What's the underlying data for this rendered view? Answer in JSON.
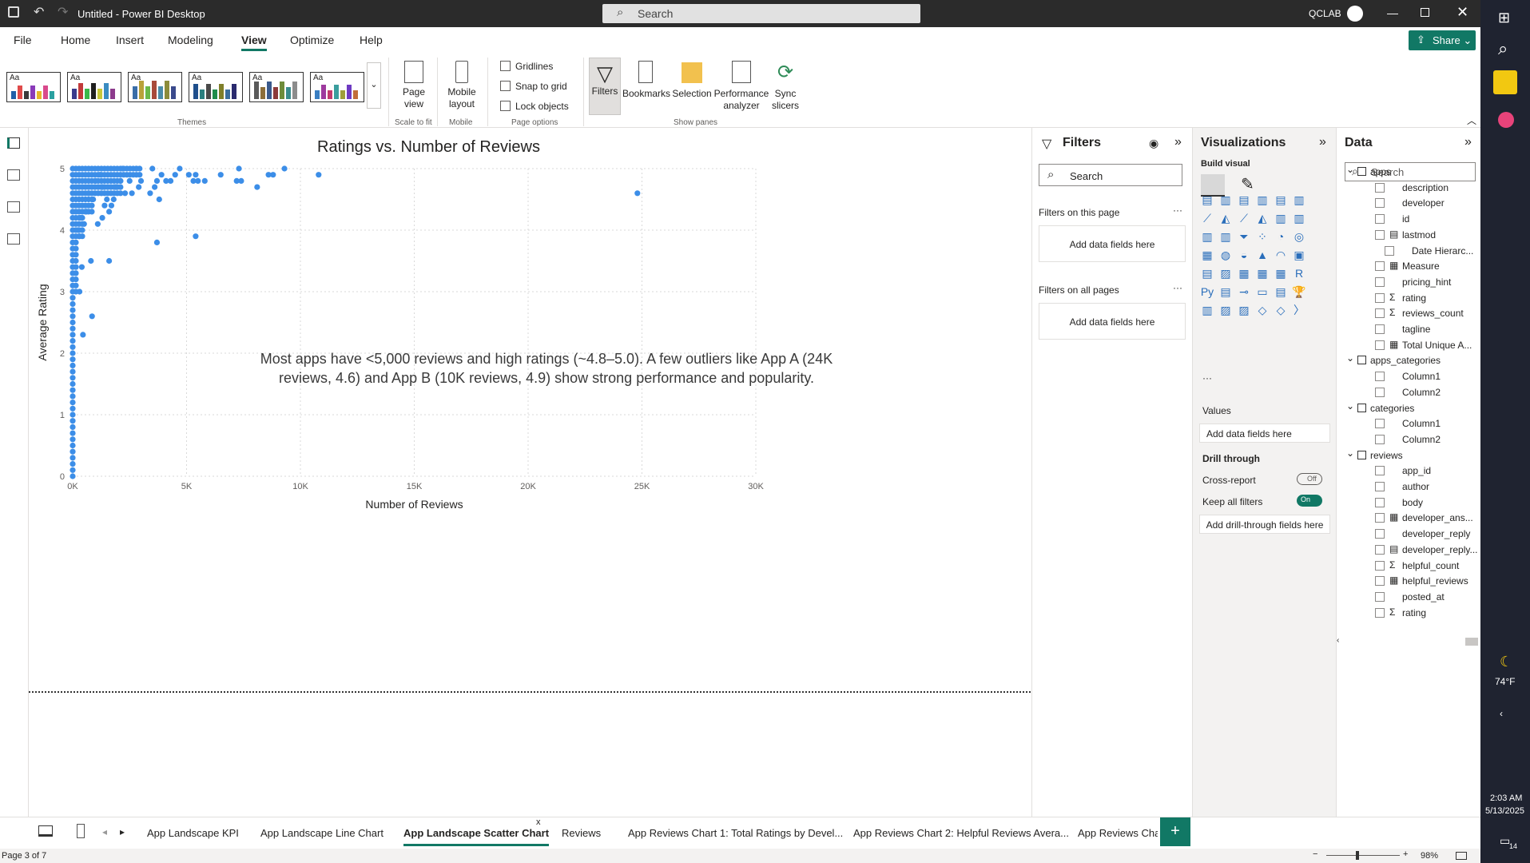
{
  "window": {
    "title": "Untitled - Power BI Desktop",
    "search_placeholder": "Search",
    "user": "QCLAB"
  },
  "menu": [
    "File",
    "Home",
    "Insert",
    "Modeling",
    "View",
    "Optimize",
    "Help"
  ],
  "menu_active": "View",
  "share_label": "Share",
  "ribbon": {
    "themes_label": "Themes",
    "page_view": "Page view",
    "scale_label": "Scale to fit",
    "mobile_layout": "Mobile layout",
    "mobile_label": "Mobile",
    "gridlines": "Gridlines",
    "snap_to_grid": "Snap to grid",
    "lock_objects": "Lock objects",
    "page_options_label": "Page options",
    "filters": "Filters",
    "bookmarks": "Bookmarks",
    "selection": "Selection",
    "performance": "Performance analyzer",
    "sync": "Sync slicers",
    "show_panes_label": "Show panes"
  },
  "chart_data": {
    "type": "scatter",
    "title": "Ratings vs. Number of Reviews",
    "xlabel": "Number of Reviews",
    "ylabel": "Average Rating",
    "xlim": [
      0,
      30000
    ],
    "ylim": [
      0,
      5
    ],
    "x_ticks": [
      "0K",
      "5K",
      "10K",
      "15K",
      "20K",
      "25K",
      "30K"
    ],
    "y_ticks": [
      "0",
      "1",
      "2",
      "3",
      "4",
      "5"
    ],
    "color": "#3c8ee8",
    "annotation": "Most apps have <5,000 reviews and high ratings (~4.8–5.0). A few outliers like App A (24K reviews, 4.6) and App B (10K reviews, 4.9) show strong performance and popularity.",
    "points": [
      [
        24800,
        4.6
      ],
      [
        10800,
        4.9
      ],
      [
        9300,
        5.0
      ],
      [
        8800,
        4.9
      ],
      [
        8600,
        4.9
      ],
      [
        7300,
        5.0
      ],
      [
        7400,
        4.8
      ],
      [
        7200,
        4.8
      ],
      [
        8100,
        4.7
      ],
      [
        6500,
        4.9
      ],
      [
        5800,
        4.8
      ],
      [
        5500,
        4.8
      ],
      [
        5300,
        4.8
      ],
      [
        5400,
        4.9
      ],
      [
        5100,
        4.9
      ],
      [
        4700,
        5.0
      ],
      [
        4500,
        4.9
      ],
      [
        4300,
        4.8
      ],
      [
        4100,
        4.8
      ],
      [
        3900,
        4.9
      ],
      [
        3700,
        4.8
      ],
      [
        3600,
        4.7
      ],
      [
        3400,
        4.6
      ],
      [
        3800,
        4.5
      ],
      [
        3500,
        5.0
      ],
      [
        3000,
        4.8
      ],
      [
        2900,
        4.7
      ],
      [
        2800,
        5.0
      ],
      [
        2500,
        4.8
      ],
      [
        2600,
        4.6
      ],
      [
        2300,
        4.6
      ],
      [
        2200,
        5.0
      ],
      [
        2100,
        4.8
      ],
      [
        1900,
        4.7
      ],
      [
        1800,
        4.5
      ],
      [
        1700,
        4.4
      ],
      [
        1500,
        4.5
      ],
      [
        1600,
        4.3
      ],
      [
        1400,
        4.4
      ],
      [
        1300,
        4.7
      ],
      [
        1200,
        4.9
      ],
      [
        1000,
        4.8
      ],
      [
        3700,
        3.8
      ],
      [
        5400,
        3.9
      ],
      [
        1600,
        3.5
      ],
      [
        800,
        3.5
      ],
      [
        850,
        2.6
      ],
      [
        450,
        2.3
      ],
      [
        300,
        3.0
      ],
      [
        400,
        3.4
      ],
      [
        300,
        3.9
      ],
      [
        250,
        4.0
      ],
      [
        500,
        4.1
      ],
      [
        350,
        4.2
      ],
      [
        600,
        4.3
      ],
      [
        700,
        4.6
      ],
      [
        900,
        4.5
      ],
      [
        1100,
        4.1
      ],
      [
        1300,
        4.2
      ]
    ]
  },
  "filters": {
    "title": "Filters",
    "search": "Search",
    "on_page": "Filters on this page",
    "on_all": "Filters on all pages",
    "add": "Add data fields here"
  },
  "viz": {
    "title": "Visualizations",
    "build": "Build visual",
    "values": "Values",
    "add_values": "Add data fields here",
    "drill": "Drill through",
    "cross": "Cross-report",
    "cross_state": "Off",
    "keep": "Keep all filters",
    "keep_state": "On",
    "add_drill": "Add drill-through fields here"
  },
  "data_pane": {
    "title": "Data",
    "search": "Search",
    "items": [
      {
        "kind": "table",
        "label": "apps",
        "level": 0
      },
      {
        "kind": "field",
        "label": "description"
      },
      {
        "kind": "field",
        "label": "developer"
      },
      {
        "kind": "field",
        "label": "id"
      },
      {
        "kind": "field",
        "label": "lastmod",
        "icon": "table"
      },
      {
        "kind": "field",
        "label": "Date Hierarc...",
        "indent": true
      },
      {
        "kind": "field",
        "label": "Measure",
        "icon": "calc"
      },
      {
        "kind": "field",
        "label": "pricing_hint"
      },
      {
        "kind": "field",
        "label": "rating",
        "sigma": true
      },
      {
        "kind": "field",
        "label": "reviews_count",
        "sigma": true
      },
      {
        "kind": "field",
        "label": "tagline"
      },
      {
        "kind": "field",
        "label": "Total Unique A...",
        "icon": "calc"
      },
      {
        "kind": "table",
        "label": "apps_categories"
      },
      {
        "kind": "field",
        "label": "Column1"
      },
      {
        "kind": "field",
        "label": "Column2"
      },
      {
        "kind": "table",
        "label": "categories"
      },
      {
        "kind": "field",
        "label": "Column1"
      },
      {
        "kind": "field",
        "label": "Column2"
      },
      {
        "kind": "table",
        "label": "reviews"
      },
      {
        "kind": "field",
        "label": "app_id"
      },
      {
        "kind": "field",
        "label": "author"
      },
      {
        "kind": "field",
        "label": "body"
      },
      {
        "kind": "field",
        "label": "developer_ans...",
        "icon": "calc"
      },
      {
        "kind": "field",
        "label": "developer_reply"
      },
      {
        "kind": "field",
        "label": "developer_reply...",
        "icon": "table"
      },
      {
        "kind": "field",
        "label": "helpful_count",
        "sigma": true
      },
      {
        "kind": "field",
        "label": "helpful_reviews",
        "icon": "calc"
      },
      {
        "kind": "field",
        "label": "posted_at"
      },
      {
        "kind": "field",
        "label": "rating",
        "sigma": true
      }
    ]
  },
  "tabs": [
    "App Landscape KPI",
    "App Landscape Line Chart",
    "App Landscape Scatter Chart",
    "Reviews",
    "App Reviews Chart 1: Total Ratings by Devel...",
    "App Reviews Chart 2: Helpful Reviews Avera...",
    "App Reviews Chart 3"
  ],
  "tab_active": "App Landscape Scatter Chart",
  "status": {
    "page": "Page 3 of 7",
    "zoom": "98%"
  },
  "taskbar": {
    "weather": "74°F",
    "time": "2:03 AM",
    "date": "5/13/2025",
    "notif": "14"
  },
  "theme_colors": [
    [
      "#1f5fa8",
      "#e04a4a",
      "#3a3a3a",
      "#8a3ab9",
      "#e8b72b",
      "#d94a8c",
      "#2aa0a0"
    ],
    [
      "#3a3a8c",
      "#c23a3a",
      "#3ab94a",
      "#1f1f1f",
      "#c7c73a",
      "#3a8cc2",
      "#8c3a8c"
    ],
    [
      "#3a6ea8",
      "#b9a23a",
      "#6ab94a",
      "#a84a3a",
      "#4a8ca8",
      "#8c8c3a",
      "#3a4a8c"
    ],
    [
      "#1f4f8c",
      "#2a7f7f",
      "#4a4a4a",
      "#1f8c4a",
      "#7f7f2a",
      "#3a6e9e",
      "#2a2a6e"
    ],
    [
      "#5a5a5a",
      "#8c6e3a",
      "#3a5a8c",
      "#8c3a3a",
      "#6e8c3a",
      "#3a8c8c",
      "#8c8c8c"
    ],
    [
      "#3a7fc2",
      "#9e3a9e",
      "#c23a6e",
      "#3a9e9e",
      "#9e9e3a",
      "#6e3ac2",
      "#c26e3a"
    ]
  ]
}
